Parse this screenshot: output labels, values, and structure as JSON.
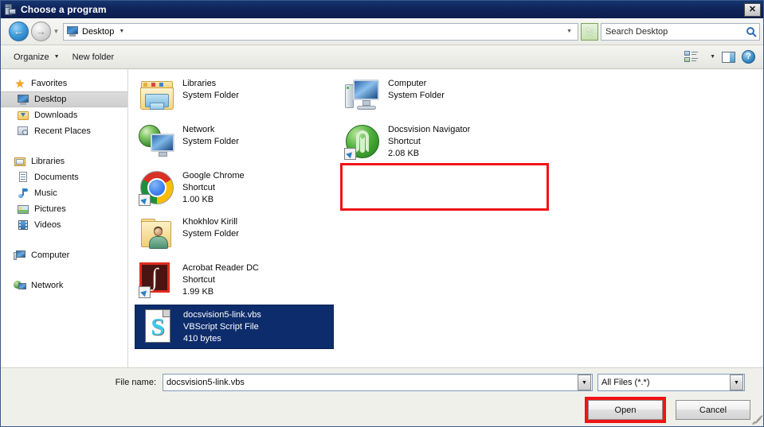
{
  "window": {
    "title": "Choose a program",
    "title_icon": "server-program-icon",
    "close_label": "✕"
  },
  "nav": {
    "back_icon": "back-arrow-icon",
    "back_glyph": "←",
    "forward_icon": "forward-arrow-icon",
    "forward_glyph": "→",
    "history_glyph": "▼",
    "breadcrumb": "Desktop",
    "breadcrumb_caret": "▼",
    "address_dropdown_glyph": "▼",
    "refresh_icon": "refresh-icon",
    "refresh_glyph": "↻"
  },
  "search": {
    "placeholder": "Search Desktop",
    "icon": "magnifier-icon"
  },
  "toolbar": {
    "organize_label": "Organize",
    "organize_caret": "▼",
    "new_folder_label": "New folder",
    "views_icon": "view-mode-icon",
    "views_caret": "▼",
    "preview_pane_icon": "preview-pane-icon",
    "help_icon": "help-icon",
    "help_glyph": "?"
  },
  "sidebar": {
    "groups": [
      {
        "header": "Favorites",
        "header_icon": "star-icon",
        "items": [
          {
            "label": "Desktop",
            "icon": "desktop-monitor-icon",
            "selected": true
          },
          {
            "label": "Downloads",
            "icon": "downloads-folder-icon",
            "selected": false
          },
          {
            "label": "Recent Places",
            "icon": "recent-places-icon",
            "selected": false
          }
        ]
      },
      {
        "header": "Libraries",
        "header_icon": "libraries-folder-icon",
        "items": [
          {
            "label": "Documents",
            "icon": "document-icon",
            "selected": false
          },
          {
            "label": "Music",
            "icon": "music-note-icon",
            "selected": false
          },
          {
            "label": "Pictures",
            "icon": "picture-icon",
            "selected": false
          },
          {
            "label": "Videos",
            "icon": "video-film-icon",
            "selected": false
          }
        ]
      },
      {
        "header": "Computer",
        "header_icon": "computer-icon",
        "items": []
      },
      {
        "header": "Network",
        "header_icon": "network-icon",
        "items": []
      }
    ]
  },
  "files": [
    {
      "name": "Libraries",
      "type": "System Folder",
      "size": "",
      "icon": "libraries-folder-icon",
      "shortcut": false,
      "selected": false
    },
    {
      "name": "Network",
      "type": "System Folder",
      "size": "",
      "icon": "network-globe-monitor-icon",
      "shortcut": false,
      "selected": false
    },
    {
      "name": "Google Chrome",
      "type": "Shortcut",
      "size": "1.00 KB",
      "icon": "google-chrome-icon",
      "shortcut": true,
      "selected": false
    },
    {
      "name": "Khokhlov Kirill",
      "type": "System Folder",
      "size": "",
      "icon": "user-folder-icon",
      "shortcut": false,
      "selected": false
    },
    {
      "name": "Acrobat Reader DC",
      "type": "Shortcut",
      "size": "1.99 KB",
      "icon": "acrobat-reader-icon",
      "shortcut": true,
      "selected": false
    },
    {
      "name": "docsvision5-link.vbs",
      "type": "VBScript Script File",
      "size": "410 bytes",
      "icon": "vbscript-file-icon",
      "shortcut": false,
      "selected": true
    },
    {
      "name": "Computer",
      "type": "System Folder",
      "size": "",
      "icon": "computer-icon",
      "shortcut": false,
      "selected": false
    },
    {
      "name": "Docsvision Navigator",
      "type": "Shortcut",
      "size": "2.08 KB",
      "icon": "docsvision-navigator-icon",
      "shortcut": true,
      "selected": false
    }
  ],
  "footer": {
    "file_name_label": "File name:",
    "file_name_value": "docsvision5-link.vbs",
    "file_name_dropdown_glyph": "▼",
    "file_type_value": "All Files (*.*)",
    "file_type_dropdown_glyph": "▼",
    "open_label": "Open",
    "cancel_label": "Cancel"
  },
  "annotations": {
    "accent_color": "#f01414",
    "selection_color": "#0d2c6b"
  }
}
